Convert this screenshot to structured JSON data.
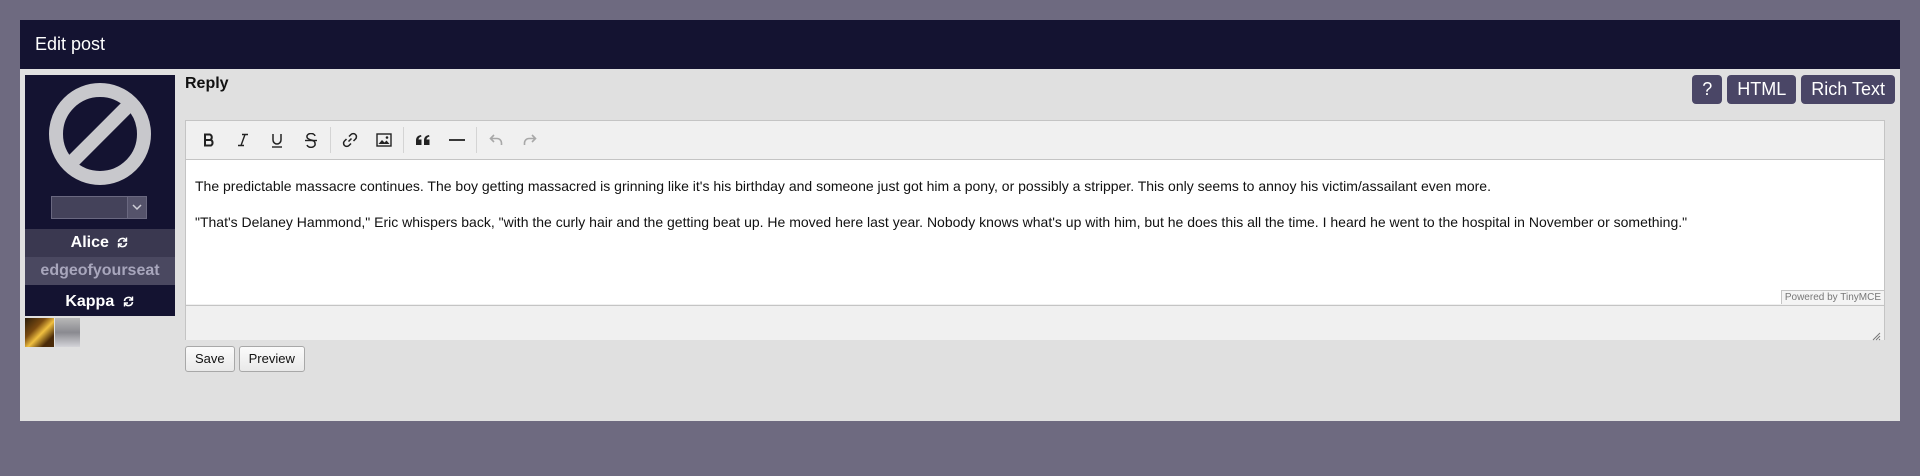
{
  "header": {
    "title": "Edit post"
  },
  "profile": {
    "name": "Alice",
    "handle": "edgeofyourseat",
    "character": "Kappa",
    "mood_selected": ""
  },
  "reply": {
    "title": "Reply",
    "mode_buttons": [
      "?",
      "HTML",
      "Rich Text"
    ],
    "paragraphs": [
      "The predictable massacre continues. The boy getting massacred is grinning like it's his birthday and someone just got him a pony, or possibly a stripper. This only seems to annoy his victim/assailant even more.",
      "\"That's Delaney Hammond,\" Eric whispers back, \"with the curly hair and the getting beat up. He moved here last year. Nobody knows what's up with him, but he does this all the time. I heard he went to the hospital in November or something.\""
    ],
    "powered_by": "Powered by TinyMCE"
  },
  "actions": {
    "save": "Save",
    "preview": "Preview"
  },
  "icons": {
    "toolbar": [
      "bold-icon",
      "italic-icon",
      "underline-icon",
      "strikethrough-icon",
      "link-icon",
      "image-icon",
      "blockquote-icon",
      "horizontal-rule-icon",
      "undo-icon",
      "redo-icon"
    ]
  },
  "colors": {
    "header_bg": "#141331",
    "page_bg": "#6e6a80",
    "panel_bg": "#e0e0e0",
    "mode_button_bg": "#4a4666"
  }
}
